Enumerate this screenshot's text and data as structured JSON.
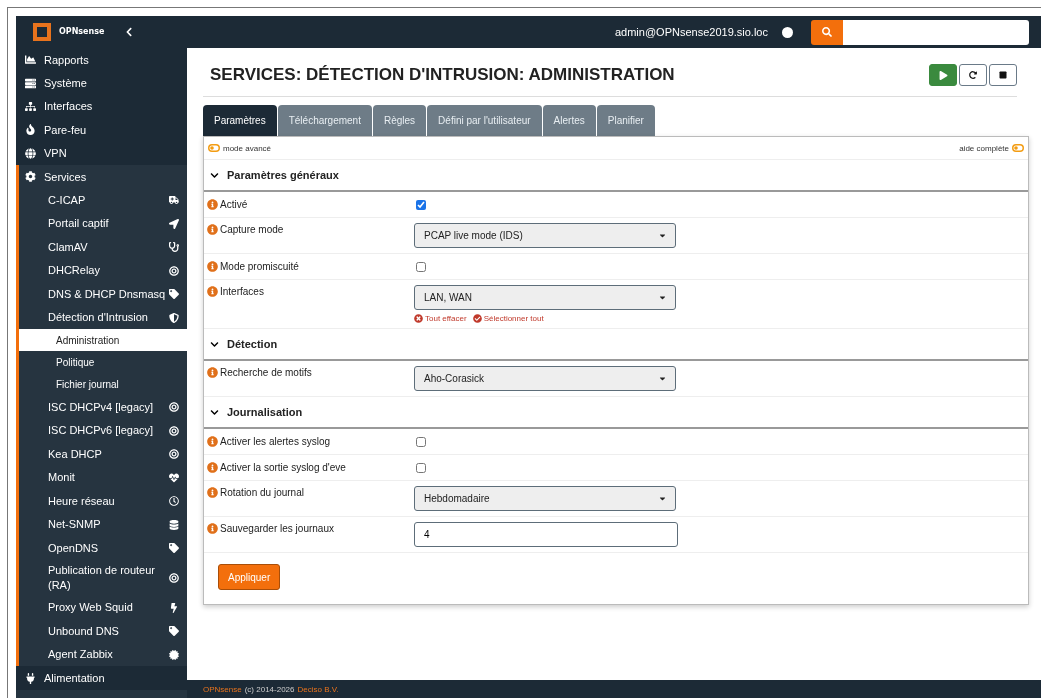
{
  "header": {
    "brand": "OPNsense",
    "user": "admin@OPNsense2019.sio.loc"
  },
  "sidebar": {
    "items": [
      {
        "label": "Rapports",
        "selected": false
      },
      {
        "label": "Système",
        "selected": false
      },
      {
        "label": "Interfaces",
        "selected": false
      },
      {
        "label": "Pare-feu",
        "selected": false
      },
      {
        "label": "VPN",
        "selected": false
      },
      {
        "label": "Services",
        "selected": true,
        "children": [
          {
            "label": "C-ICAP"
          },
          {
            "label": "Portail captif"
          },
          {
            "label": "ClamAV"
          },
          {
            "label": "DHCRelay"
          },
          {
            "label": "DNS & DHCP Dnsmasq"
          },
          {
            "label": "Détection d'Intrusion",
            "children": [
              {
                "label": "Administration",
                "selected": true
              },
              {
                "label": "Politique",
                "selected": false
              },
              {
                "label": "Fichier journal",
                "selected": false
              }
            ]
          },
          {
            "label": "ISC DHCPv4 [legacy]"
          },
          {
            "label": "ISC DHCPv6 [legacy]"
          },
          {
            "label": "Kea DHCP"
          },
          {
            "label": "Monit"
          },
          {
            "label": "Heure réseau"
          },
          {
            "label": "Net-SNMP"
          },
          {
            "label": "OpenDNS"
          },
          {
            "label": "Publication de routeur (RA)"
          },
          {
            "label": "Proxy Web Squid"
          },
          {
            "label": "Unbound DNS"
          },
          {
            "label": "Agent Zabbix"
          }
        ]
      },
      {
        "label": "Alimentation",
        "selected": false
      }
    ]
  },
  "page": {
    "title": "SERVICES: DÉTECTION D'INTRUSION: ADMINISTRATION",
    "tabs": [
      {
        "label": "Paramètres",
        "selected": true
      },
      {
        "label": "Téléchargement",
        "selected": false
      },
      {
        "label": "Règles",
        "selected": false
      },
      {
        "label": "Défini par l'utilisateur",
        "selected": false
      },
      {
        "label": "Alertes",
        "selected": false
      },
      {
        "label": "Planifier",
        "selected": false
      }
    ],
    "advanced_mode": "mode avancé",
    "full_help": "aide complète",
    "sections": [
      {
        "title": "Paramètres généraux",
        "fields": [
          {
            "kind": "checkbox",
            "label": "Activé",
            "checked": true
          },
          {
            "kind": "select",
            "label": "Capture mode",
            "value": "PCAP live mode (IDS)"
          },
          {
            "kind": "checkbox",
            "label": "Mode promiscuité",
            "checked": false
          },
          {
            "kind": "select",
            "label": "Interfaces",
            "value": "LAN, WAN",
            "actions": [
              {
                "kind": "clear",
                "label": "Tout effacer"
              },
              {
                "kind": "select",
                "label": "Sélectionner tout"
              }
            ]
          }
        ]
      },
      {
        "title": "Détection",
        "fields": [
          {
            "kind": "select",
            "label": "Recherche de motifs",
            "value": "Aho-Corasick"
          }
        ]
      },
      {
        "title": "Journalisation",
        "fields": [
          {
            "kind": "checkbox",
            "label": "Activer les alertes syslog",
            "checked": false
          },
          {
            "kind": "checkbox",
            "label": "Activer la sortie syslog d'eve",
            "checked": false
          },
          {
            "kind": "select",
            "label": "Rotation du journal",
            "value": "Hebdomadaire"
          },
          {
            "kind": "text",
            "label": "Sauvegarder les journaux",
            "value": "4"
          }
        ]
      }
    ],
    "apply_button": "Appliquer"
  },
  "footer": {
    "brand": "OPNsense",
    "copyright": "(c) 2014-2026",
    "company": "Deciso B.V."
  }
}
